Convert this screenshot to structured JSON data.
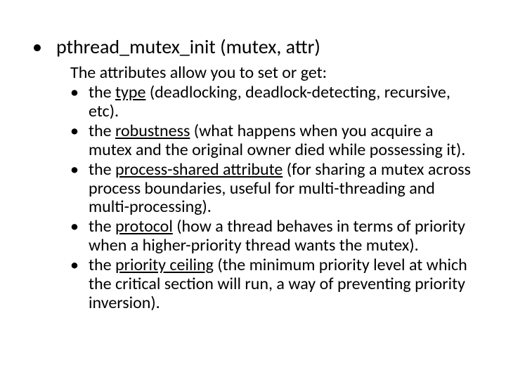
{
  "title": "pthread_mutex_init (mutex, attr)",
  "intro": "The attributes allow you to set or get:",
  "items": [
    {
      "label": "type",
      "pre": "the ",
      "post": " (deadlocking, deadlock-detecting, recursive, etc)."
    },
    {
      "label": "robustness",
      "pre": "the ",
      "post": " (what happens when you acquire a mutex and the original owner died while possessing it)."
    },
    {
      "label": "process-shared attribute",
      "pre": "the ",
      "post": " (for sharing a mutex across process boundaries, useful for multi-threading and multi-processing)."
    },
    {
      "label": "protocol",
      "pre": "the ",
      "post": " (how a thread behaves in terms of priority when a higher-priority thread wants the mutex)."
    },
    {
      "label": "priority ceiling",
      "pre": "the ",
      "post": " (the minimum priority level at which the critical section will run, a way of preventing priority inversion)."
    }
  ]
}
